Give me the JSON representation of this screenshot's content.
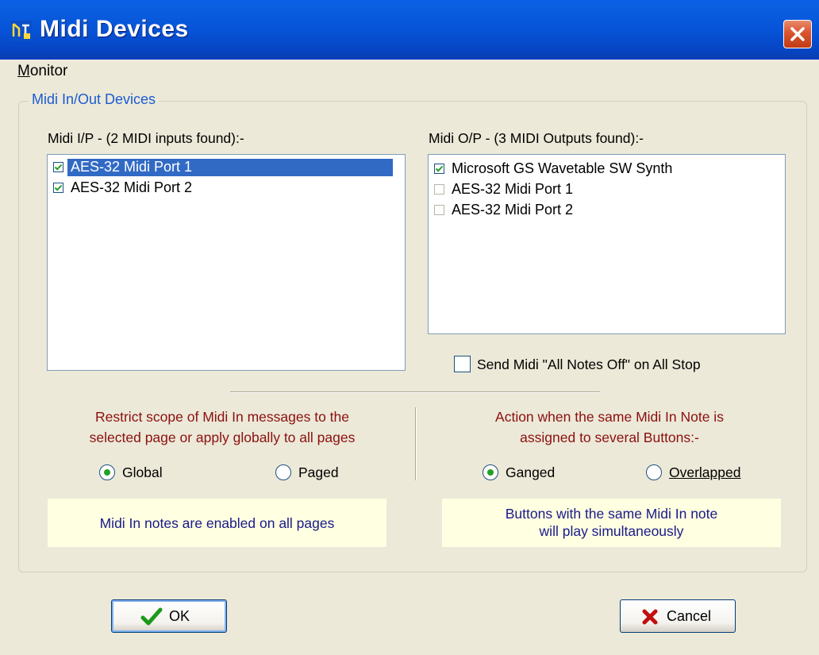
{
  "window": {
    "title": "Midi Devices"
  },
  "menu": {
    "items": [
      {
        "label": "Monitor"
      }
    ]
  },
  "group": {
    "title": "Midi In/Out Devices"
  },
  "inputs": {
    "header": "Midi I/P - (2 MIDI inputs found):-",
    "items": [
      {
        "label": "AES-32 Midi Port 1",
        "checked": true,
        "selected": true
      },
      {
        "label": "AES-32 Midi Port 2",
        "checked": true,
        "selected": false
      }
    ]
  },
  "outputs": {
    "header": "Midi O/P - (3 MIDI Outputs found):-",
    "items": [
      {
        "label": "Microsoft GS Wavetable SW Synth",
        "checked": true
      },
      {
        "label": "AES-32 Midi Port 1",
        "checked": false
      },
      {
        "label": "AES-32 Midi Port 2",
        "checked": false
      }
    ]
  },
  "all_notes_off": {
    "label": "Send Midi \"All Notes Off\" on All Stop",
    "checked": false
  },
  "scope": {
    "description_line1": "Restrict scope of Midi In messages to the",
    "description_line2": "selected page or apply globally to all pages",
    "options": [
      {
        "label": "Global",
        "selected": true
      },
      {
        "label": "Paged",
        "selected": false
      }
    ],
    "info": "Midi In notes are enabled on all pages"
  },
  "action": {
    "description_line1": "Action when the same Midi In Note is",
    "description_line2": "assigned to several Buttons:-",
    "options": [
      {
        "label": "Ganged",
        "selected": true
      },
      {
        "label": "Overlapped",
        "selected": false
      }
    ],
    "info_line1": "Buttons with the same Midi In note",
    "info_line2": "will play simultaneously"
  },
  "buttons": {
    "ok": "OK",
    "cancel": "Cancel"
  },
  "colors": {
    "titlebar": "#0754d8",
    "selection": "#316ac5",
    "description_text": "#8b1010",
    "info_bg": "#ffffe1",
    "group_title": "#1d5bd1"
  }
}
